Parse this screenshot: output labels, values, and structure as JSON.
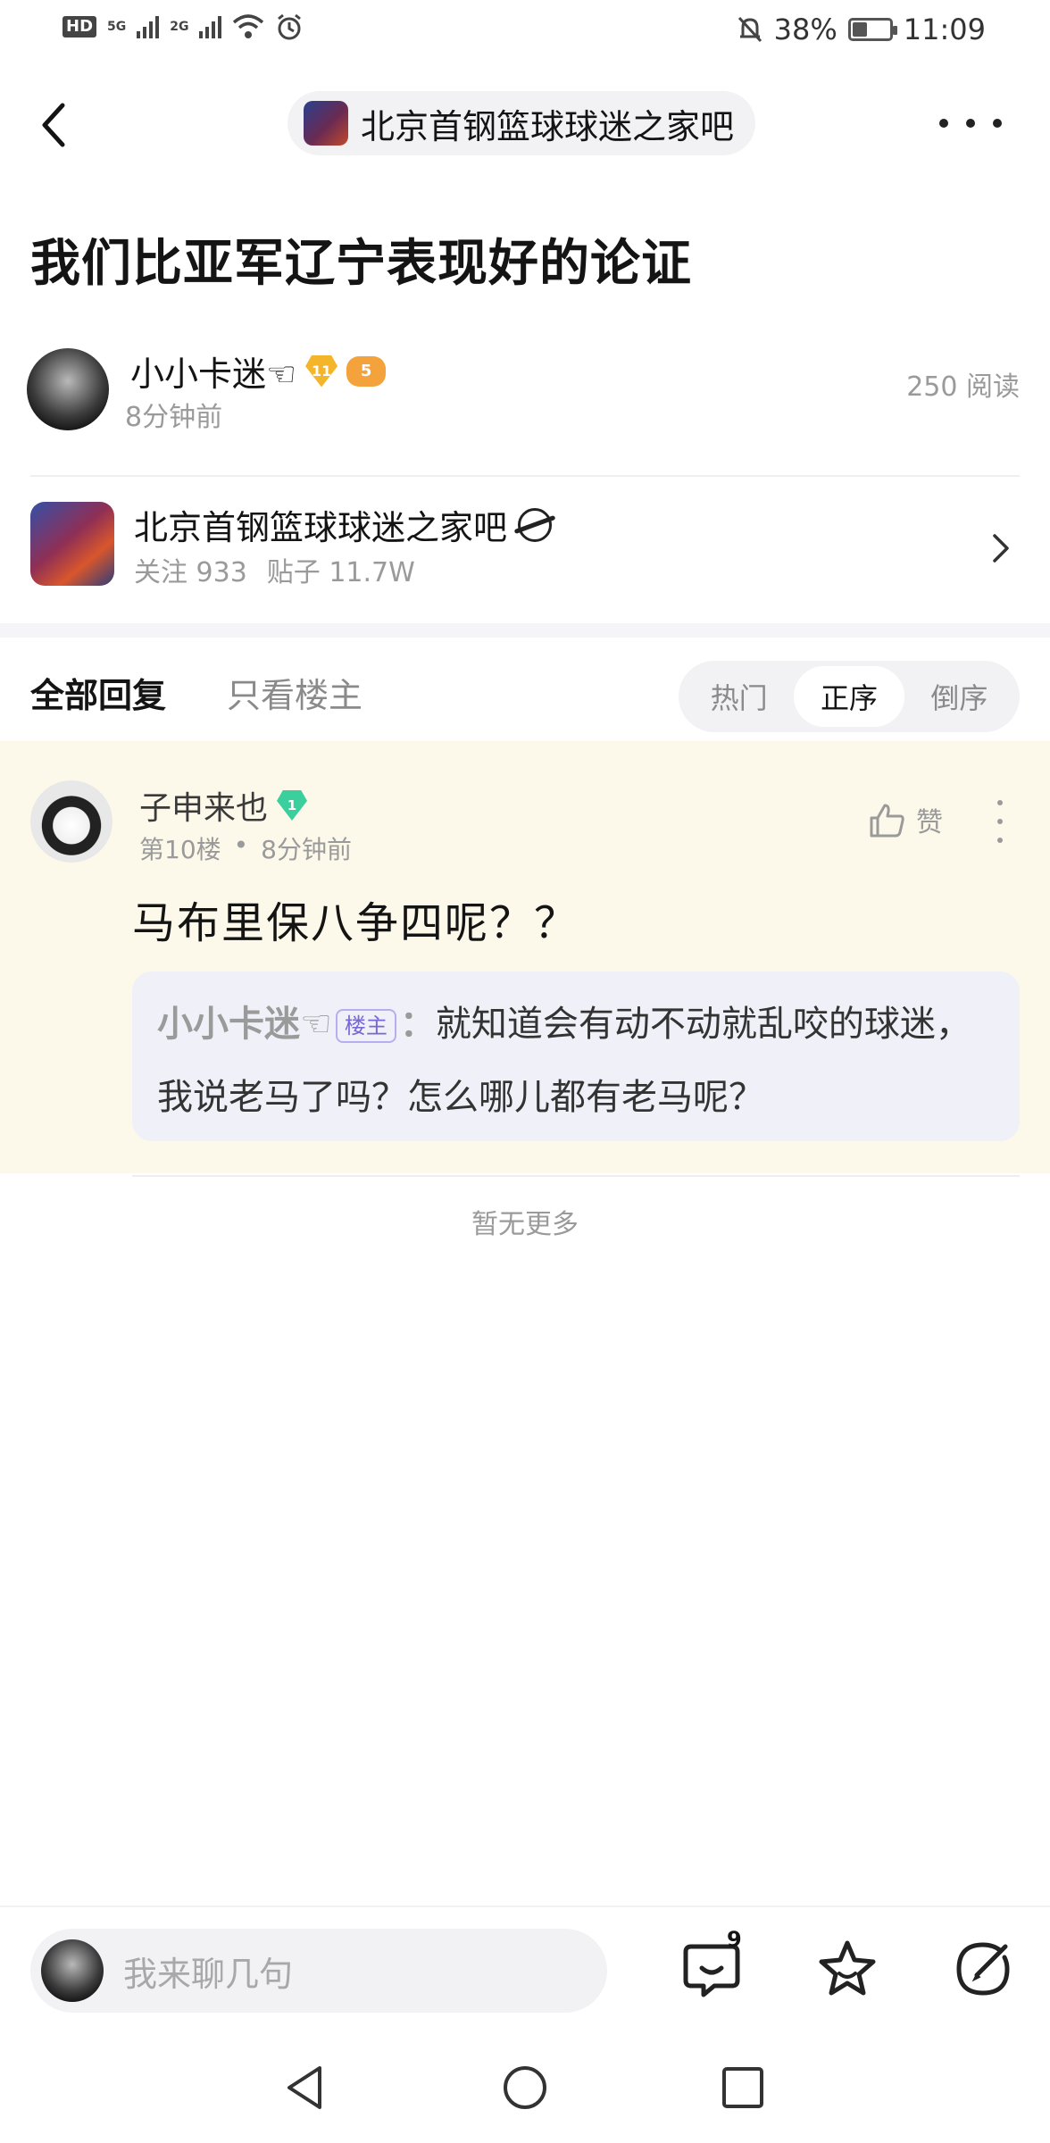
{
  "status_bar": {
    "hd": "HD",
    "net1": "5G",
    "net2": "2G",
    "battery_percent": "38%",
    "time": "11:09"
  },
  "header": {
    "forum_name": "北京首钢篮球球迷之家吧"
  },
  "post": {
    "title": "我们比亚军辽宁表现好的论证",
    "author_name": "小小卡迷☜",
    "author_level_badge": "11",
    "author_game_badge": "5",
    "post_time": "8分钟前",
    "read_count": "250 阅读"
  },
  "forum_card": {
    "name": "北京首钢篮球球迷之家吧",
    "followers": "关注 933",
    "posts": "贴子 11.7W"
  },
  "tabs": {
    "all_replies": "全部回复",
    "only_op": "只看楼主",
    "sort": [
      "热门",
      "正序",
      "倒序"
    ],
    "active_sort": "正序"
  },
  "reply": {
    "user_name": "子申来也",
    "user_level": "1",
    "floor": "第10楼",
    "dot": "•",
    "time": "8分钟前",
    "like_label": "赞",
    "content": "马布里保八争四呢？？",
    "quote": {
      "name": "小小卡迷☜",
      "op_tag": "楼主",
      "colon": "：",
      "text": "就知道会有动不动就乱咬的球迷，我说老马了吗？怎么哪儿都有老马呢？"
    }
  },
  "footer_text": "暂无更多",
  "bottom_bar": {
    "input_placeholder": "我来聊几句",
    "emoji_count": "9"
  },
  "colors": {
    "reply_bg": "#fdf9ea",
    "quote_bg": "#f0f0f8",
    "op_tag": "#7867d4",
    "gold_badge": "#f5b52a",
    "teal_badge": "#3ccf9e"
  }
}
